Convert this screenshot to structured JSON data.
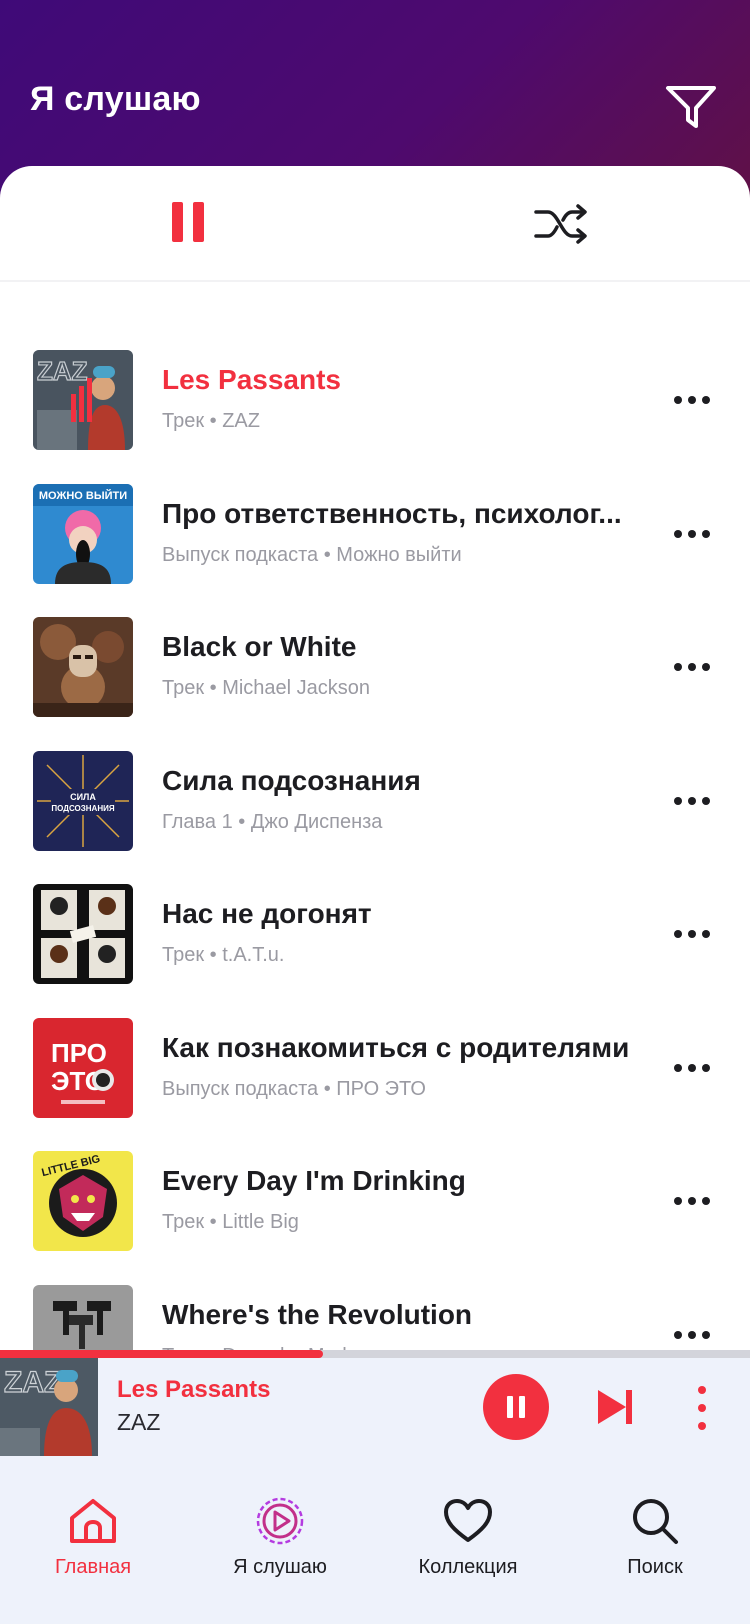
{
  "header": {
    "title": "Я слушаю",
    "filter_icon": "filter-icon"
  },
  "controls": {
    "pause_icon": "pause-icon",
    "shuffle_icon": "shuffle-icon"
  },
  "tracks": [
    {
      "title": "Les Passants",
      "subtitle": "Трек • ZAZ",
      "active": true
    },
    {
      "title": "Про ответственность, психолог...",
      "subtitle": "Выпуск подкаста • Можно выйти",
      "active": false
    },
    {
      "title": "Black or White",
      "subtitle": "Трек • Michael Jackson",
      "active": false
    },
    {
      "title": "Сила подсознания",
      "subtitle": "Глава 1 • Джо Диспенза",
      "active": false
    },
    {
      "title": "Нас не догонят",
      "subtitle": "Трек • t.A.T.u.",
      "active": false
    },
    {
      "title": "Как познакомиться с родителями",
      "subtitle": "Выпуск подкаста • ПРО ЭТО",
      "active": false
    },
    {
      "title": "Every Day I'm Drinking",
      "subtitle": "Трек • Little Big",
      "active": false
    },
    {
      "title": "Where's the Revolution",
      "subtitle": "Трек • Depeche Mode",
      "active": false
    }
  ],
  "covers": {
    "zaz": "ZAZ",
    "mozhno": "МОЖНО ВЫЙТИ",
    "sila_line1": "СИЛА",
    "sila_line2": "ПОДСОЗНАНИЯ",
    "pro_line1": "ПРО",
    "pro_line2": "ЭТО",
    "little_big": "LITTLE BIG"
  },
  "player": {
    "title": "Les Passants",
    "artist": "ZAZ",
    "progress": 0.43,
    "pause_icon": "pause-icon",
    "next_icon": "skip-next-icon",
    "menu_icon": "more-vertical-icon"
  },
  "nav": [
    {
      "label": "Главная",
      "icon": "home-icon",
      "active": true
    },
    {
      "label": "Я слушаю",
      "icon": "listening-icon",
      "active": false
    },
    {
      "label": "Коллекция",
      "icon": "heart-icon",
      "active": false
    },
    {
      "label": "Поиск",
      "icon": "search-icon",
      "active": false
    }
  ],
  "colors": {
    "accent": "#f2303f",
    "header_start": "#3f0a78",
    "header_end": "#611144",
    "nav_bg": "#eef2fb"
  }
}
